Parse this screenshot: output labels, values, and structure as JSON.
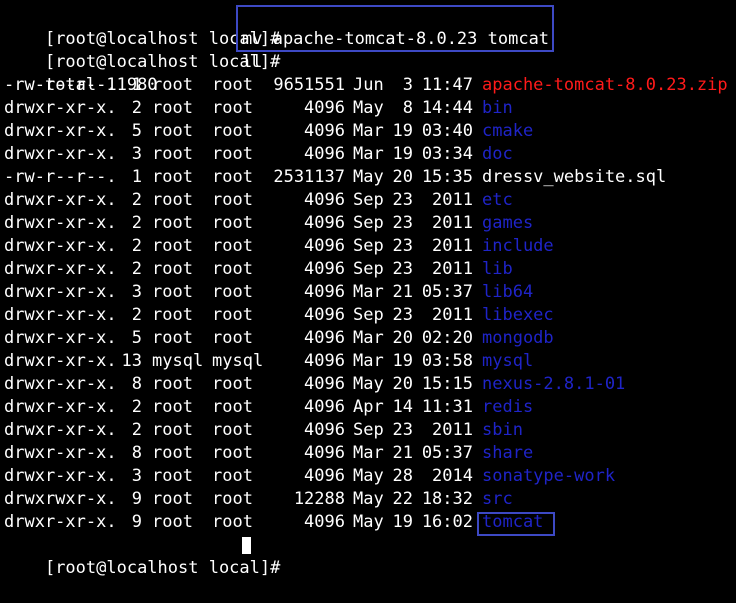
{
  "terminal": {
    "prompt": "[root@localhost local]#",
    "commands": [
      {
        "text": "mv apache-tomcat-8.0.23 tomcat"
      },
      {
        "text": "ll"
      }
    ],
    "total_line": "total 11980",
    "listing": [
      {
        "perms": "-rw-r--r--.",
        "links": "1",
        "owner": "root",
        "group": "root",
        "size": "9651551",
        "month": "Jun",
        "day": "3",
        "time": "11:47",
        "name": "apache-tomcat-8.0.23.zip",
        "kind": "archive"
      },
      {
        "perms": "drwxr-xr-x.",
        "links": "2",
        "owner": "root",
        "group": "root",
        "size": "4096",
        "month": "May",
        "day": "8",
        "time": "14:44",
        "name": "bin",
        "kind": "dir"
      },
      {
        "perms": "drwxr-xr-x.",
        "links": "5",
        "owner": "root",
        "group": "root",
        "size": "4096",
        "month": "Mar",
        "day": "19",
        "time": "03:40",
        "name": "cmake",
        "kind": "dir"
      },
      {
        "perms": "drwxr-xr-x.",
        "links": "3",
        "owner": "root",
        "group": "root",
        "size": "4096",
        "month": "Mar",
        "day": "19",
        "time": "03:34",
        "name": "doc",
        "kind": "dir"
      },
      {
        "perms": "-rw-r--r--.",
        "links": "1",
        "owner": "root",
        "group": "root",
        "size": "2531137",
        "month": "May",
        "day": "20",
        "time": "15:35",
        "name": "dressv_website.sql",
        "kind": "file"
      },
      {
        "perms": "drwxr-xr-x.",
        "links": "2",
        "owner": "root",
        "group": "root",
        "size": "4096",
        "month": "Sep",
        "day": "23",
        "time": "2011",
        "name": "etc",
        "kind": "dir"
      },
      {
        "perms": "drwxr-xr-x.",
        "links": "2",
        "owner": "root",
        "group": "root",
        "size": "4096",
        "month": "Sep",
        "day": "23",
        "time": "2011",
        "name": "games",
        "kind": "dir"
      },
      {
        "perms": "drwxr-xr-x.",
        "links": "2",
        "owner": "root",
        "group": "root",
        "size": "4096",
        "month": "Sep",
        "day": "23",
        "time": "2011",
        "name": "include",
        "kind": "dir"
      },
      {
        "perms": "drwxr-xr-x.",
        "links": "2",
        "owner": "root",
        "group": "root",
        "size": "4096",
        "month": "Sep",
        "day": "23",
        "time": "2011",
        "name": "lib",
        "kind": "dir"
      },
      {
        "perms": "drwxr-xr-x.",
        "links": "3",
        "owner": "root",
        "group": "root",
        "size": "4096",
        "month": "Mar",
        "day": "21",
        "time": "05:37",
        "name": "lib64",
        "kind": "dir"
      },
      {
        "perms": "drwxr-xr-x.",
        "links": "2",
        "owner": "root",
        "group": "root",
        "size": "4096",
        "month": "Sep",
        "day": "23",
        "time": "2011",
        "name": "libexec",
        "kind": "dir"
      },
      {
        "perms": "drwxr-xr-x.",
        "links": "5",
        "owner": "root",
        "group": "root",
        "size": "4096",
        "month": "Mar",
        "day": "20",
        "time": "02:20",
        "name": "mongodb",
        "kind": "dir"
      },
      {
        "perms": "drwxr-xr-x.",
        "links": "13",
        "owner": "mysql",
        "group": "mysql",
        "size": "4096",
        "month": "Mar",
        "day": "19",
        "time": "03:58",
        "name": "mysql",
        "kind": "dir"
      },
      {
        "perms": "drwxr-xr-x.",
        "links": "8",
        "owner": "root",
        "group": "root",
        "size": "4096",
        "month": "May",
        "day": "20",
        "time": "15:15",
        "name": "nexus-2.8.1-01",
        "kind": "dir"
      },
      {
        "perms": "drwxr-xr-x.",
        "links": "2",
        "owner": "root",
        "group": "root",
        "size": "4096",
        "month": "Apr",
        "day": "14",
        "time": "11:31",
        "name": "redis",
        "kind": "dir"
      },
      {
        "perms": "drwxr-xr-x.",
        "links": "2",
        "owner": "root",
        "group": "root",
        "size": "4096",
        "month": "Sep",
        "day": "23",
        "time": "2011",
        "name": "sbin",
        "kind": "dir"
      },
      {
        "perms": "drwxr-xr-x.",
        "links": "8",
        "owner": "root",
        "group": "root",
        "size": "4096",
        "month": "Mar",
        "day": "21",
        "time": "05:37",
        "name": "share",
        "kind": "dir"
      },
      {
        "perms": "drwxr-xr-x.",
        "links": "3",
        "owner": "root",
        "group": "root",
        "size": "4096",
        "month": "May",
        "day": "28",
        "time": "2014",
        "name": "sonatype-work",
        "kind": "dir"
      },
      {
        "perms": "drwxrwxr-x.",
        "links": "9",
        "owner": "root",
        "group": "root",
        "size": "12288",
        "month": "May",
        "day": "22",
        "time": "18:32",
        "name": "src",
        "kind": "dir"
      },
      {
        "perms": "drwxr-xr-x.",
        "links": "9",
        "owner": "root",
        "group": "root",
        "size": "4096",
        "month": "May",
        "day": "19",
        "time": "16:02",
        "name": "tomcat",
        "kind": "dir"
      }
    ]
  },
  "colors": {
    "background": "#000000",
    "text": "#ffffff",
    "directory": "#1f24c8",
    "archive": "#ff1a1a",
    "highlight_border": "#3d49c4"
  }
}
